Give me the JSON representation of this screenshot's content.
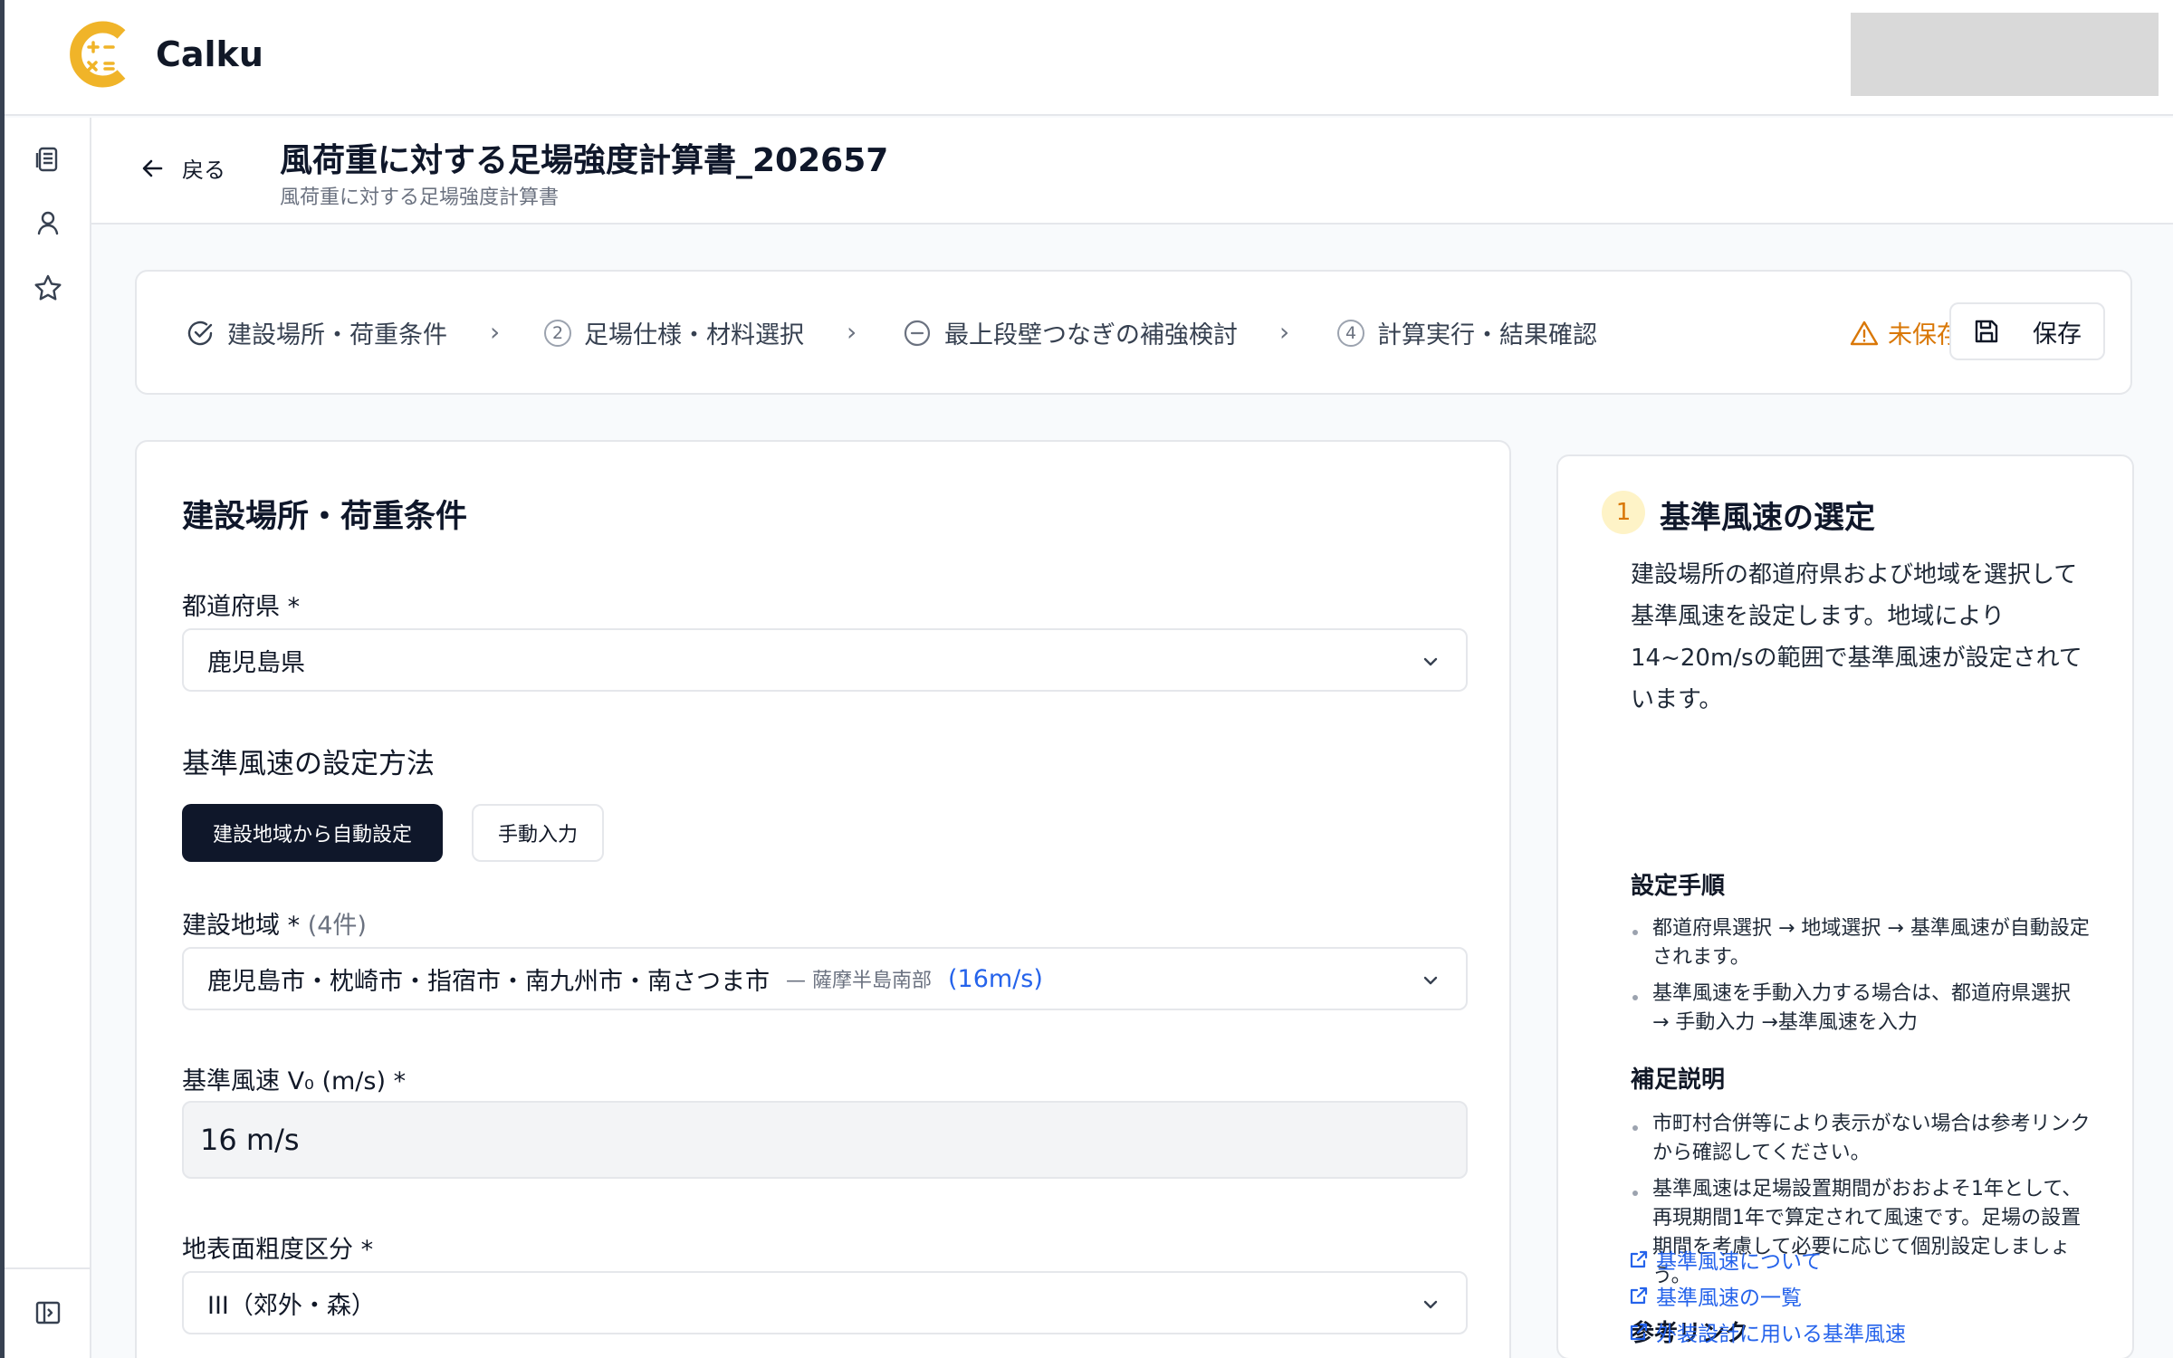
{
  "app": {
    "name": "Calku"
  },
  "header": {
    "back_label": "戻る",
    "title": "風荷重に対する足場強度計算書_202657",
    "subtitle": "風荷重に対する足場強度計算書"
  },
  "steps": [
    {
      "label": "建設場所・荷重条件",
      "state": "completed"
    },
    {
      "number": "2",
      "label": "足場仕様・材料選択",
      "state": "pending"
    },
    {
      "label": "最上段壁つなぎの補強検討",
      "state": "skipped"
    },
    {
      "number": "4",
      "label": "計算実行・結果確認",
      "state": "pending"
    }
  ],
  "status": {
    "unsaved_label": "未保存",
    "save_label": "保存"
  },
  "form": {
    "title": "建設場所・荷重条件",
    "prefecture": {
      "label": "都道府県 *",
      "value": "鹿児島県"
    },
    "method": {
      "label": "基準風速の設定方法",
      "auto_label": "建設地域から自動設定",
      "manual_label": "手動入力"
    },
    "region": {
      "label": "建設地域 *",
      "count": "(4件)",
      "value": "鹿児島市・枕崎市・指宿市・南九州市・南さつま市",
      "sub": "— 薩摩半島南部",
      "speed": "(16m/s)"
    },
    "wind_speed": {
      "label": "基準風速 V₀ (m/s) *",
      "value": "16 m/s"
    },
    "roughness": {
      "label": "地表面粗度区分 *",
      "value": "III（郊外・森）"
    }
  },
  "help": {
    "number": "1",
    "title": "基準風速の選定",
    "intro": "建設場所の都道府県および地域を選択して基準風速を設定します。地域により14~20m/sの範囲で基準風速が設定されています。",
    "procedure_title": "設定手順",
    "procedure": [
      "都道府県選択 → 地域選択 → 基準風速が自動設定されます。",
      "基準風速を手動入力する場合は、都道府県選択 → 手動入力 →基準風速を入力"
    ],
    "notes_title": "補足説明",
    "notes": [
      "市町村合併等により表示がない場合は参考リンクから確認してください。",
      "基準風速は足場設置期間がおおよそ1年として、再現期間1年で算定されて風速です。足場の設置期間を考慮して必要に応じて個別設定しましょう。"
    ],
    "links_title": "参考リンク",
    "links": [
      "基準風速について",
      "基準風速の一覧",
      "外装設計に用いる基準風速"
    ]
  },
  "colors": {
    "accent": "#f0b429",
    "primary_dark": "#0f172a",
    "link": "#2563eb",
    "warning": "#d97706"
  }
}
